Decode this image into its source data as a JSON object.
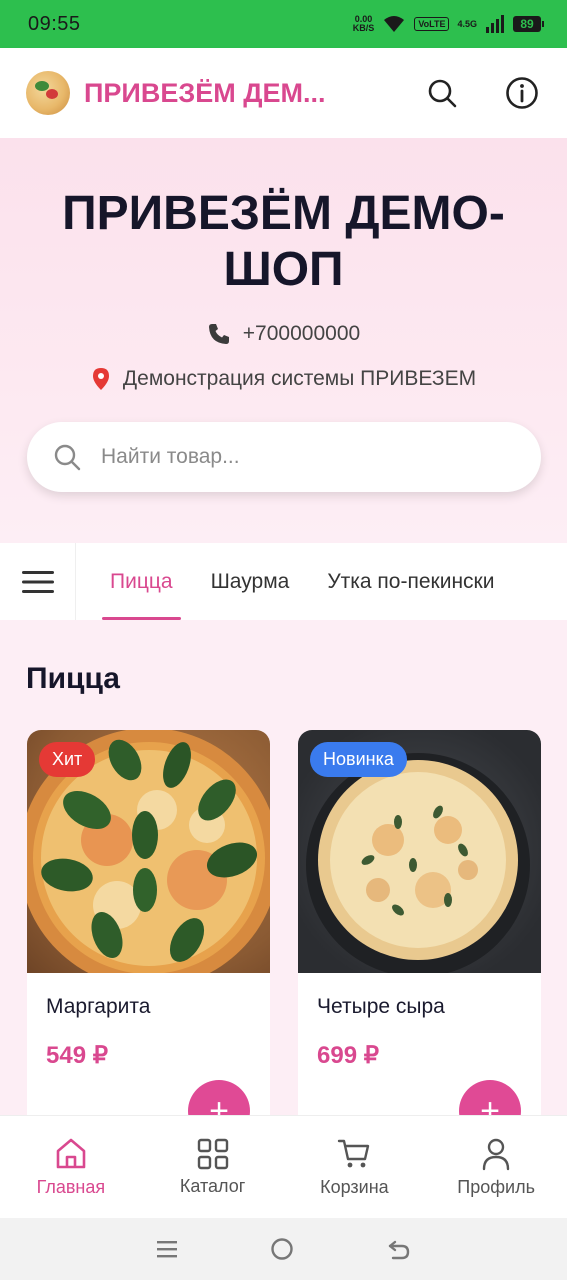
{
  "status_bar": {
    "time": "09:55",
    "net_speed_value": "0.00",
    "net_speed_unit": "KB/S",
    "volte": "VoLTE",
    "network": "4.5G",
    "battery": "89"
  },
  "app_bar": {
    "title": "ПРИВЕЗЁМ ДЕМ..."
  },
  "hero": {
    "title": "ПРИВЕЗЁМ ДЕМО-ШОП",
    "phone": "+700000000",
    "address": "Демонстрация системы ПРИВЕЗЕМ"
  },
  "search": {
    "placeholder": "Найти товар..."
  },
  "categories": {
    "tabs": [
      {
        "label": "Пицца",
        "active": true
      },
      {
        "label": "Шаурма",
        "active": false
      },
      {
        "label": "Утка по-пекински",
        "active": false
      }
    ]
  },
  "section": {
    "title": "Пицца"
  },
  "products": [
    {
      "name": "Маргарита",
      "price": "549 ₽",
      "badge": "Хит",
      "add_label": "+"
    },
    {
      "name": "Четыре сыра",
      "price": "699 ₽",
      "badge": "Новинка",
      "add_label": "+"
    }
  ],
  "bottom_nav": [
    {
      "label": "Главная",
      "icon": "home-icon",
      "active": true
    },
    {
      "label": "Каталог",
      "icon": "grid-icon",
      "active": false
    },
    {
      "label": "Корзина",
      "icon": "cart-icon",
      "active": false
    },
    {
      "label": "Профиль",
      "icon": "user-icon",
      "active": false
    }
  ],
  "colors": {
    "accent": "#d9488f",
    "status_bar": "#2dbf4e",
    "badge_hit": "#e53935",
    "badge_new": "#3a7bee"
  }
}
